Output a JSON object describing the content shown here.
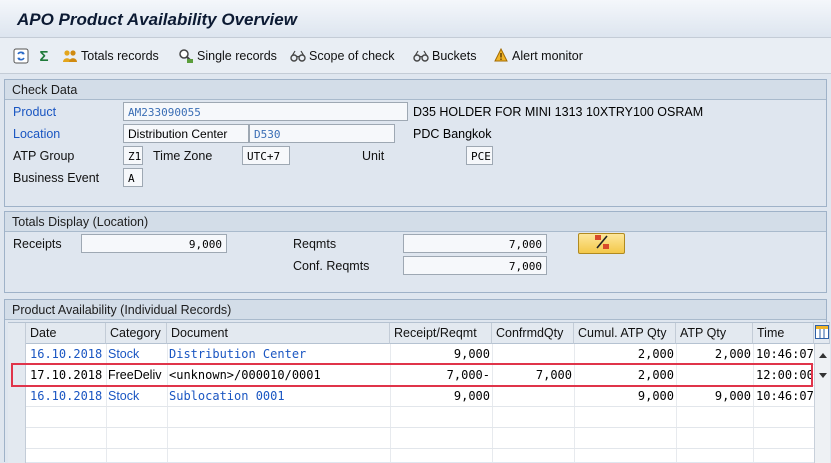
{
  "title": "APO Product Availability Overview",
  "toolbar": {
    "totals_records": "Totals records",
    "single_records": "Single records",
    "scope_of_check": "Scope of check",
    "buckets": "Buckets",
    "alert_monitor": "Alert monitor"
  },
  "check_data": {
    "header": "Check Data",
    "product_label": "Product",
    "product_value": "AM233090055",
    "product_desc": "D35 HOLDER FOR MINI 1313 10XTRY100 OSRAM",
    "location_label": "Location",
    "location_type": "Distribution Center",
    "location_value": "D530",
    "location_desc": "PDC Bangkok",
    "atp_group_label": "ATP Group",
    "atp_group_value": "Z1",
    "time_zone_label": "Time Zone",
    "time_zone_value": "UTC+7",
    "unit_label": "Unit",
    "unit_value": "PCE",
    "business_event_label": "Business Event",
    "business_event_value": "A"
  },
  "totals_display": {
    "header": "Totals Display (Location)",
    "receipts_label": "Receipts",
    "receipts_value": "9,000",
    "reqmts_label": "Reqmts",
    "reqmts_value": "7,000",
    "conf_reqmts_label": "Conf. Reqmts",
    "conf_reqmts_value": "7,000"
  },
  "product_availability": {
    "header": "Product Availability (Individual Records)",
    "columns": [
      "Date",
      "Category",
      "Document",
      "Receipt/Reqmt",
      "ConfrmdQty",
      "Cumul. ATP Qty",
      "ATP Qty",
      "Time"
    ],
    "rows": [
      {
        "date": "16.10.2018",
        "category": "Stock",
        "document": "Distribution Center",
        "receipt": "9,000",
        "confirmed": "",
        "cumul": "2,000",
        "atp": "2,000",
        "time": "10:46:07"
      },
      {
        "date": "17.10.2018",
        "category": "FreeDeliv",
        "document": "<unknown>/000010/0001",
        "receipt": "7,000-",
        "confirmed": "7,000",
        "cumul": "2,000",
        "atp": "",
        "time": "12:00:00"
      },
      {
        "date": "16.10.2018",
        "category": "Stock",
        "document": "Sublocation 0001",
        "receipt": "9,000",
        "confirmed": "",
        "cumul": "9,000",
        "atp": "9,000",
        "time": "10:46:07"
      }
    ]
  },
  "colors": {
    "link": "#1a56c2",
    "highlight": "#e0344a"
  }
}
